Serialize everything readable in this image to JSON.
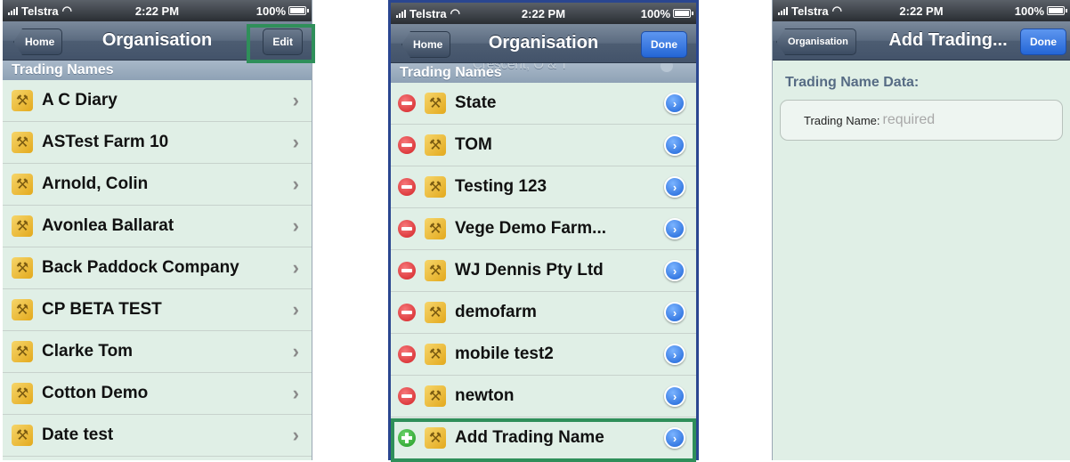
{
  "status": {
    "carrier": "Telstra",
    "time": "2:22 PM",
    "battery": "100%"
  },
  "screen1": {
    "back_label": "Home",
    "title": "Organisation",
    "edit_label": "Edit",
    "section": "Trading Names",
    "items": [
      {
        "label": "A C Diary"
      },
      {
        "label": "ASTest Farm 10"
      },
      {
        "label": "Arnold, Colin"
      },
      {
        "label": "Avonlea Ballarat"
      },
      {
        "label": "Back Paddock Company"
      },
      {
        "label": "CP BETA TEST"
      },
      {
        "label": "Clarke Tom"
      },
      {
        "label": "Cotton Demo"
      },
      {
        "label": "Date test"
      }
    ]
  },
  "screen2": {
    "back_label": "Home",
    "title": "Organisation",
    "done_label": "Done",
    "section": "Trading Names",
    "ghost_text": "Crescent, O & T",
    "items": [
      {
        "label": "State"
      },
      {
        "label": "TOM"
      },
      {
        "label": "Testing 123"
      },
      {
        "label": "Vege Demo Farm..."
      },
      {
        "label": "WJ Dennis Pty Ltd"
      },
      {
        "label": "demofarm"
      },
      {
        "label": "mobile test2"
      },
      {
        "label": "newton"
      }
    ],
    "add_label": "Add Trading Name"
  },
  "screen3": {
    "back_label": "Organisation",
    "title": "Add Trading...",
    "done_label": "Done",
    "section_title": "Trading Name Data:",
    "field_label": "Trading Name:",
    "field_placeholder": "required"
  },
  "colors": {
    "highlight": "#2f8f5a",
    "navbar": "#5b6b80",
    "row_bg": "#e0efe6",
    "done_blue": "#2466d6"
  }
}
